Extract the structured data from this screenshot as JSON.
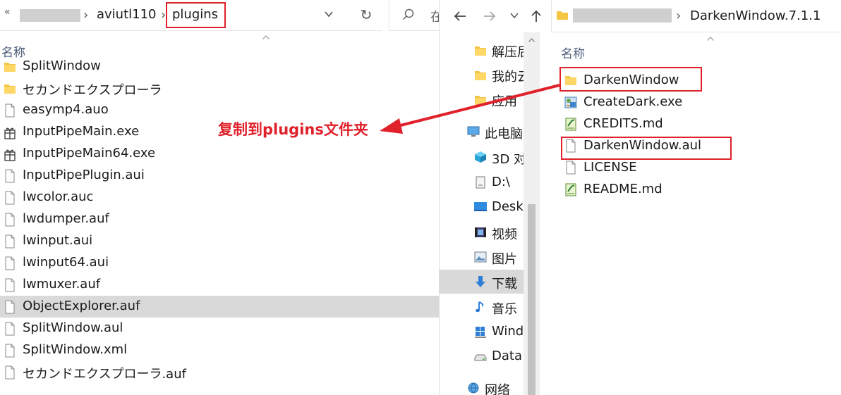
{
  "left_explorer": {
    "breadcrumb_prefix": "«",
    "breadcrumb": [
      "aviutl110",
      "plugins"
    ],
    "search_placeholder": "在",
    "column_header": "名称",
    "files": [
      {
        "name": "SplitWindow",
        "icon": "folder-icon",
        "selected": false
      },
      {
        "name": "セカンドエクスプローラ",
        "icon": "folder-icon",
        "selected": false
      },
      {
        "name": "easymp4.auo",
        "icon": "file-icon",
        "selected": false
      },
      {
        "name": "InputPipeMain.exe",
        "icon": "exe-icon",
        "selected": false
      },
      {
        "name": "InputPipeMain64.exe",
        "icon": "exe-icon",
        "selected": false
      },
      {
        "name": "InputPipePlugin.aui",
        "icon": "file-icon",
        "selected": false
      },
      {
        "name": "lwcolor.auc",
        "icon": "file-icon",
        "selected": false
      },
      {
        "name": "lwdumper.auf",
        "icon": "file-icon",
        "selected": false
      },
      {
        "name": "lwinput.aui",
        "icon": "file-icon",
        "selected": false
      },
      {
        "name": "lwinput64.aui",
        "icon": "file-icon",
        "selected": false
      },
      {
        "name": "lwmuxer.auf",
        "icon": "file-icon",
        "selected": false
      },
      {
        "name": "ObjectExplorer.auf",
        "icon": "file-icon",
        "selected": true
      },
      {
        "name": "SplitWindow.aul",
        "icon": "file-icon",
        "selected": false
      },
      {
        "name": "SplitWindow.xml",
        "icon": "file-icon",
        "selected": false
      },
      {
        "name": "セカンドエクスプローラ.auf",
        "icon": "file-icon",
        "selected": false
      }
    ]
  },
  "annotation": {
    "text": "复制到plugins文件夹",
    "color": "#e0202a"
  },
  "right_explorer": {
    "breadcrumb_current": "DarkenWindow.7.1.1",
    "column_header": "名称",
    "nav_items": [
      {
        "name": "解压后",
        "icon": "folder-icon",
        "selected": false
      },
      {
        "name": "我的云",
        "icon": "folder-icon",
        "selected": false
      },
      {
        "name": "应用",
        "icon": "folder-icon",
        "selected": false
      },
      {
        "name": "此电脑",
        "icon": "computer-icon",
        "selected": false
      },
      {
        "name": "3D 对",
        "icon": "3d-objects-icon",
        "selected": false
      },
      {
        "name": "D:\\",
        "icon": "drive-icon",
        "selected": false
      },
      {
        "name": "Desk",
        "icon": "desktop-icon",
        "selected": false
      },
      {
        "name": "视频",
        "icon": "video-icon",
        "selected": false
      },
      {
        "name": "图片",
        "icon": "picture-icon",
        "selected": false
      },
      {
        "name": "下载",
        "icon": "download-icon",
        "selected": true
      },
      {
        "name": "音乐",
        "icon": "music-icon",
        "selected": false
      },
      {
        "name": "Wind",
        "icon": "windows-drive-icon",
        "selected": false
      },
      {
        "name": "Data",
        "icon": "hdd-icon",
        "selected": false
      },
      {
        "name": "网络",
        "icon": "network-icon",
        "selected": false
      }
    ],
    "files": [
      {
        "name": "DarkenWindow",
        "icon": "folder-icon",
        "highlighted": true
      },
      {
        "name": "CreateDark.exe",
        "icon": "installer-icon",
        "highlighted": false
      },
      {
        "name": "CREDITS.md",
        "icon": "notepad-icon",
        "highlighted": false
      },
      {
        "name": "DarkenWindow.aul",
        "icon": "file-icon",
        "highlighted": true
      },
      {
        "name": "LICENSE",
        "icon": "file-icon",
        "highlighted": false
      },
      {
        "name": "README.md",
        "icon": "notepad-icon",
        "highlighted": false
      }
    ]
  },
  "colors": {
    "highlight_red": "#e0202a",
    "selection_gray": "#d9d9d9",
    "folder_yellow": "#f4c542",
    "column_header_blue": "#4a5b78"
  }
}
